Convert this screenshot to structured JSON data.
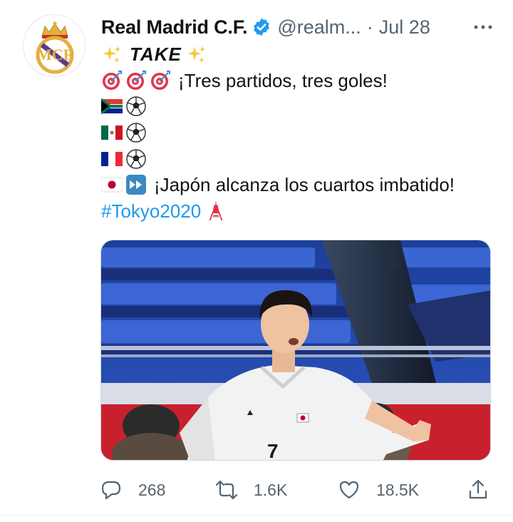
{
  "tweet": {
    "author": {
      "display_name": "Real Madrid C.F.",
      "handle": "@realm...",
      "verified": true,
      "avatar_icon": "real-madrid-crest"
    },
    "separator": "·",
    "date": "Jul 28",
    "more_icon": "more-horizontal-icon",
    "text": {
      "line1_word": "TAKE",
      "line2": "¡Tres partidos, tres goles!",
      "line6": "¡Japón alcanza los cuartos imbatido!",
      "hashtag": "#Tokyo2020"
    },
    "media": {
      "icon": "player-celebration-photo",
      "jersey_number": "7"
    },
    "actions": {
      "replies": "268",
      "retweets": "1.6K",
      "likes": "18.5K"
    }
  },
  "colors": {
    "text": "#0f1419",
    "secondary": "#536471",
    "accent": "#1d9bf0",
    "verified": "#1d9bf0"
  }
}
